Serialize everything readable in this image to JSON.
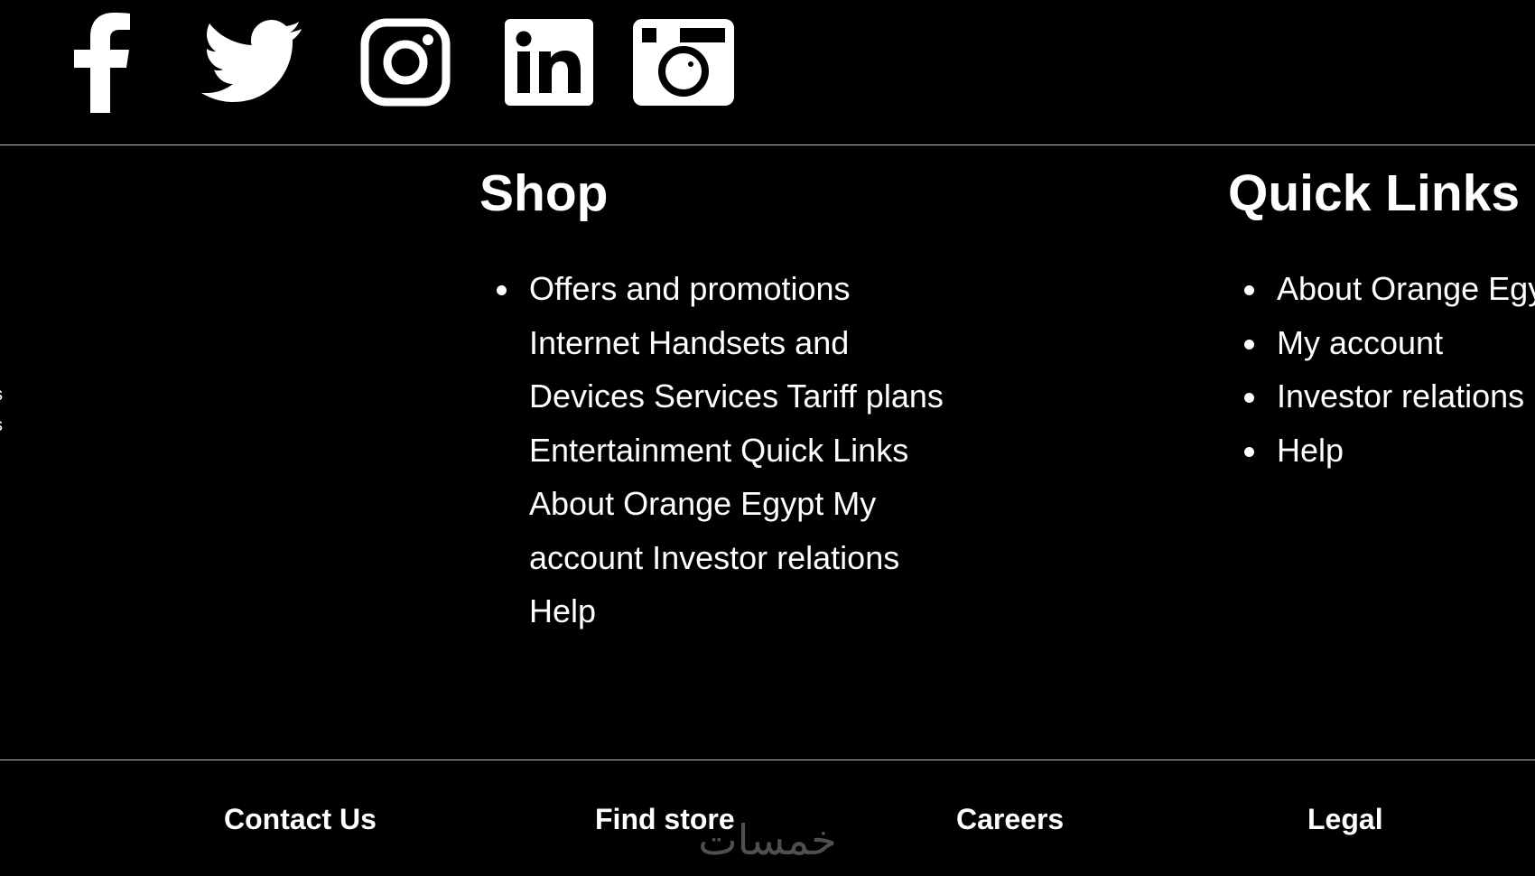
{
  "social": {
    "icons": [
      "facebook-icon",
      "twitter-icon",
      "instagram-icon",
      "linkedin-icon",
      "camera-icon"
    ]
  },
  "edge_fragments": [
    "s",
    "s"
  ],
  "shop": {
    "heading": "Shop",
    "item": "Offers and promotions Internet Handsets and Devices Services Tariff plans Entertainment Quick Links About Orange Egypt My account Investor relations Help"
  },
  "quick_links": {
    "heading": "Quick Links",
    "items": [
      "About Orange Egypt",
      "My account",
      "Investor relations",
      "Help"
    ]
  },
  "bottom_links": {
    "contact": "Contact Us",
    "find_store": "Find store",
    "careers": "Careers",
    "legal": "Legal"
  },
  "watermark": {
    "text": "خمسات"
  },
  "colors": {
    "background": "#000000",
    "text": "#ffffff",
    "divider": "#bdbdbd"
  }
}
